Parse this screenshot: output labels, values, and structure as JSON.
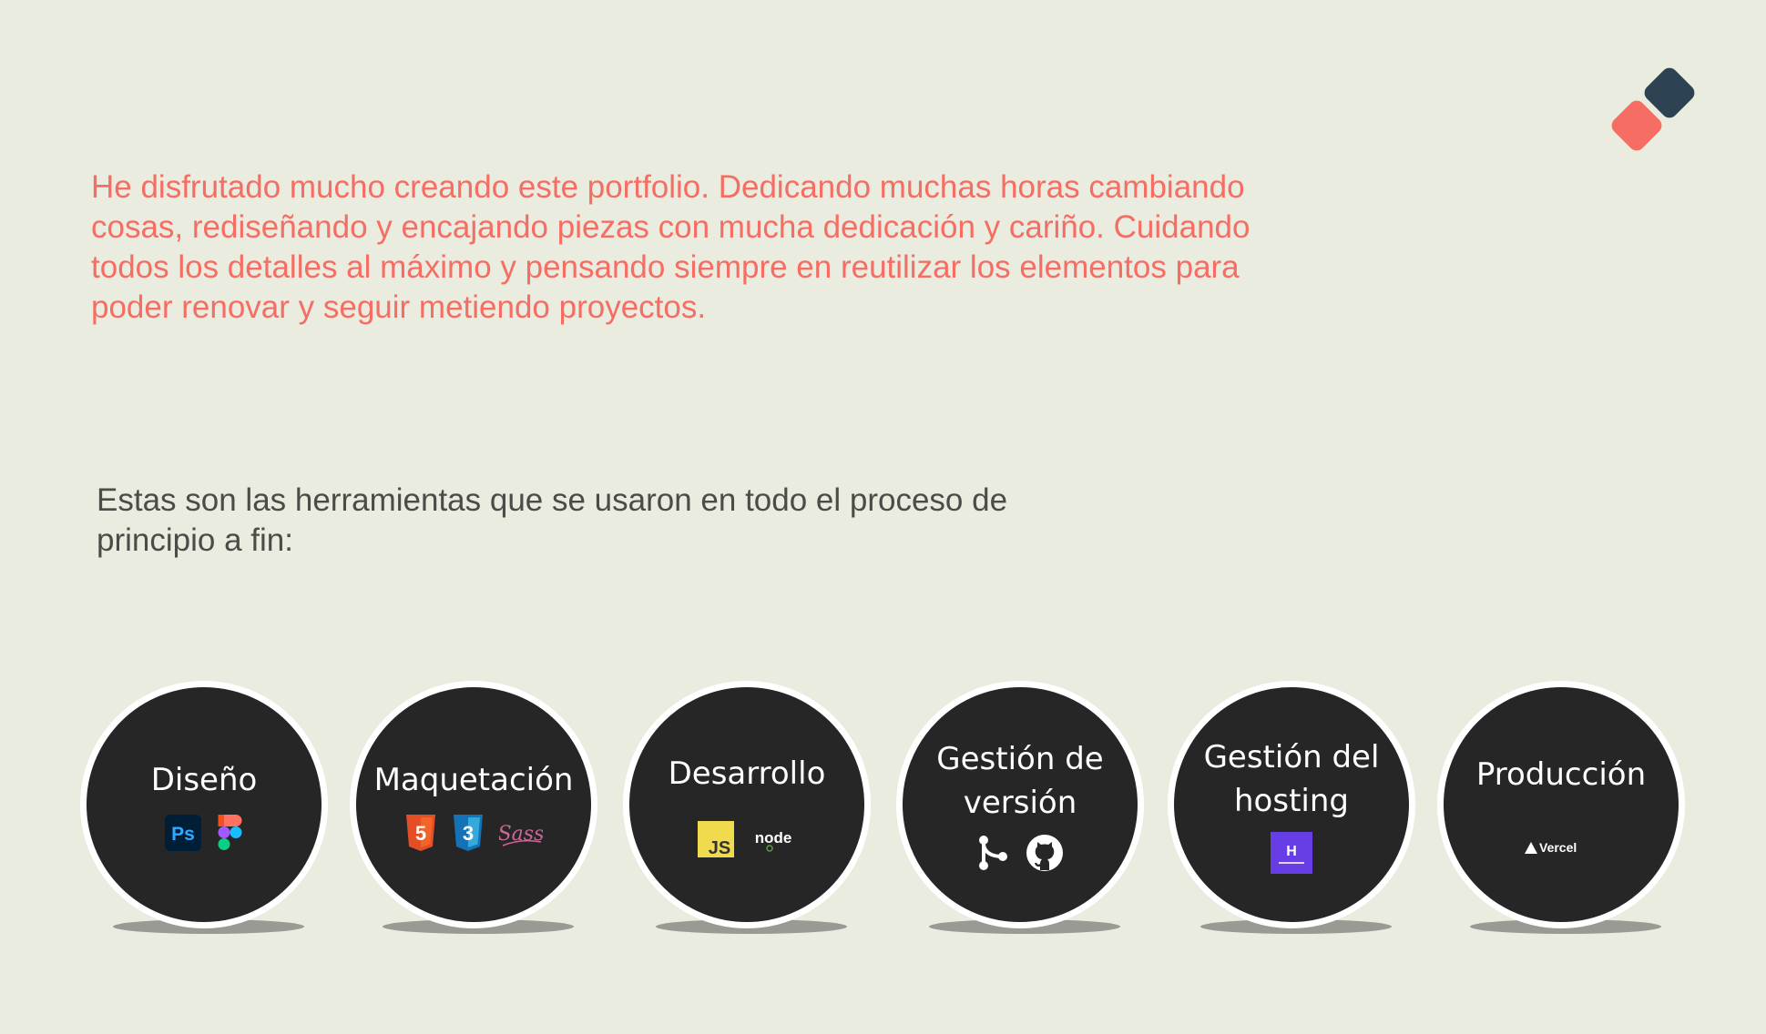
{
  "intro_text": "He disfrutado mucho creando este portfolio. Dedicando muchas horas cambiando cosas, rediseñando y encajando piezas con mucha dedicación y cariño. Cuidando todos los detalles al máximo y pensando siempre en reutilizar los elementos para poder renovar y seguir metiendo proyectos.",
  "tools_title": "Estas son las herramientas que se usaron en todo el proceso de principio a fin:",
  "colors": {
    "background": "#e9ecdf",
    "accent": "#f56d63",
    "logo_dark": "#2d4354",
    "circle": "#262626"
  },
  "tools": [
    {
      "label": "Diseño",
      "icons": [
        "photoshop-icon",
        "figma-icon"
      ],
      "ps_text": "Ps"
    },
    {
      "label": "Maquetación",
      "icons": [
        "html5-icon",
        "css3-icon",
        "sass-icon"
      ],
      "html_text": "5",
      "css_text": "3",
      "sass_text": "Sass"
    },
    {
      "label": "Desarrollo",
      "icons": [
        "javascript-icon",
        "nodejs-icon"
      ],
      "js_text": "JS",
      "node_text": "node"
    },
    {
      "label": "Gestión de versión",
      "icons": [
        "git-icon",
        "github-icon"
      ]
    },
    {
      "label": "Gestión del hosting",
      "icons": [
        "hostinger-icon"
      ],
      "hostinger_text": "H"
    },
    {
      "label": "Producción",
      "icons": [
        "vercel-icon"
      ],
      "vercel_text": "Vercel"
    }
  ]
}
